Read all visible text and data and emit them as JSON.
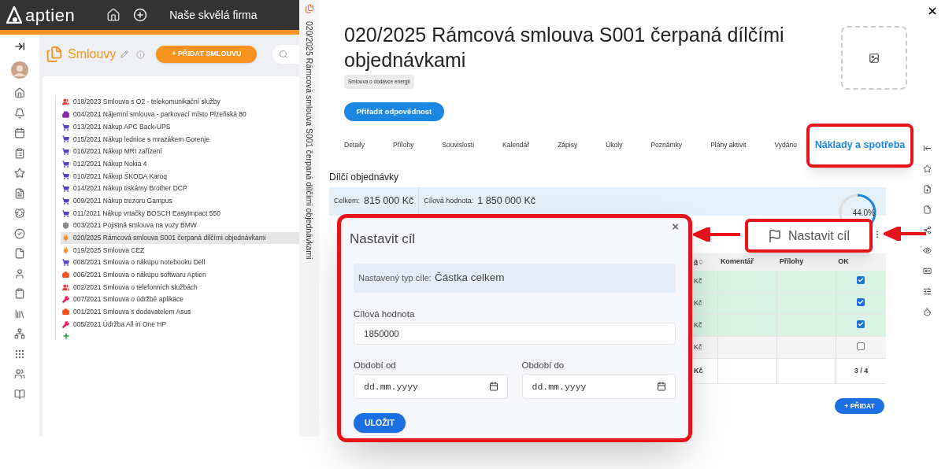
{
  "top_bar": {
    "logo": "aptien",
    "company": "Naše skvělá firma"
  },
  "module": {
    "title": "Smlouvy",
    "add_button": "+ PŘIDAT SMLOUVU"
  },
  "contracts": [
    {
      "label": "018/2023  Smlouva s O2 - telekomunikační služby",
      "kind": "people",
      "color": "#e8413c",
      "selected": false
    },
    {
      "label": "004/2021 Nájemní smlouva - parkovací místo Plzeňská 80",
      "kind": "building",
      "color": "#8e24aa",
      "selected": false
    },
    {
      "label": "013/2021 Nákup APC Back-UPS",
      "kind": "cart",
      "color": "#5b3fc4",
      "selected": false
    },
    {
      "label": "015/2021 Nákup lednice s mrazákem Gorenje",
      "kind": "cart",
      "color": "#5b3fc4",
      "selected": false
    },
    {
      "label": "016/2021 Nákup MRI zařízení",
      "kind": "cart",
      "color": "#5b3fc4",
      "selected": false
    },
    {
      "label": "012/2021 Nákup Nokia 4",
      "kind": "cart",
      "color": "#5b3fc4",
      "selected": false
    },
    {
      "label": "010/2021 Nákup ŠKODA Karoq",
      "kind": "cart",
      "color": "#5b3fc4",
      "selected": false
    },
    {
      "label": "014/2021 Nákup tiskárny Brother DCP",
      "kind": "cart",
      "color": "#5b3fc4",
      "selected": false
    },
    {
      "label": "009/2021 Nákup trezoru Gampus",
      "kind": "cart",
      "color": "#5b3fc4",
      "selected": false
    },
    {
      "label": "011/2021 Nákup vrtačky BOSCH EasyImpact 550",
      "kind": "cart",
      "color": "#5b3fc4",
      "selected": false
    },
    {
      "label": "003/2021 Pojistná smlouva na vozy BMW",
      "kind": "shield",
      "color": "#8a8a8a",
      "selected": false
    },
    {
      "label": "020/2025 Rámcová smlouva S001 čerpaná dílčími objednávkami",
      "kind": "plug",
      "color": "#f39325",
      "selected": true
    },
    {
      "label": "019/2025 Smlouva CEZ",
      "kind": "plug",
      "color": "#f39325",
      "selected": false
    },
    {
      "label": "008/2021 Smlouva o nákupu notebooku Dell",
      "kind": "cart",
      "color": "#5b3fc4",
      "selected": false
    },
    {
      "label": "006/2021 Smlouva o nákupu softwaru Aptien",
      "kind": "briefcase",
      "color": "#f4511e",
      "selected": false
    },
    {
      "label": "002/2021 Smlouva o telefonních službách",
      "kind": "people",
      "color": "#e8413c",
      "selected": false
    },
    {
      "label": "007/2021 Smlouva o údržbě aplikace",
      "kind": "tools",
      "color": "#e91e63",
      "selected": false
    },
    {
      "label": "001/2021 Smlouva s dodavatelem Asus",
      "kind": "briefcase",
      "color": "#f4511e",
      "selected": false
    },
    {
      "label": "005/2021 Údržba All in One HP",
      "kind": "tools",
      "color": "#e91e63",
      "selected": false
    }
  ],
  "side_tab": {
    "text": "020/2025 Rámcová smlouva S001 čerpaná dílčími objednávkami"
  },
  "detail": {
    "title": "020/2025 Rámcová smlouva S001 čerpaná dílčími objednávkami",
    "category": "Smlouva o dodávce energií",
    "assign_button": "Přiřadit odpovědnost",
    "tabs": [
      {
        "label": "Detaily",
        "selected": false
      },
      {
        "label": "Přílohy",
        "selected": false
      },
      {
        "label": "Souvislosti",
        "selected": false
      },
      {
        "label": "Kalendář",
        "selected": false
      },
      {
        "label": "Zápisy",
        "selected": false
      },
      {
        "label": "Úkoly",
        "selected": false
      },
      {
        "label": "Poznámky",
        "selected": false
      },
      {
        "label": "Plány aktivit",
        "selected": false
      },
      {
        "label": "Vydáno",
        "selected": false
      },
      {
        "label": "Náklady a spotřeba",
        "selected": true
      }
    ],
    "section_title": "Dílčí objednávky",
    "summary": [
      {
        "label": "Celkem:",
        "value": "815 000 Kč"
      },
      {
        "label": "Cílová hodnota:",
        "value": "1 850 000 Kč"
      }
    ],
    "progress": {
      "level": 0.44,
      "reading": "44.0%"
    },
    "table": {
      "columns": [
        "a",
        "Komentář",
        "Přílohy",
        "OK"
      ],
      "rows": [
        {
          "column_1": "Kč",
          "checked": true
        },
        {
          "column_1": "Kč",
          "checked": true
        },
        {
          "column_1": "Kč",
          "checked": true
        },
        {
          "column_1": "Kč",
          "checked": false
        }
      ],
      "total": {
        "column_1": "Kč",
        "ok": "3 / 4"
      }
    },
    "add_button": "+ PŘIDAT"
  },
  "callout": {
    "label": "Nastavit cíl"
  },
  "dialog": {
    "title": "Nastavit cíl",
    "close": "×",
    "info_label": "Nastavený typ cíle:",
    "info_value": "Částka celkem",
    "fields": [
      {
        "label": "Cílová hodnota",
        "value": "1850000"
      }
    ],
    "dates": [
      {
        "label": "Období od",
        "placeholder": "dd.mm.yyyy"
      },
      {
        "label": "Období do",
        "placeholder": "dd.mm.yyyy"
      }
    ],
    "save_button": "ULOŽIT"
  }
}
